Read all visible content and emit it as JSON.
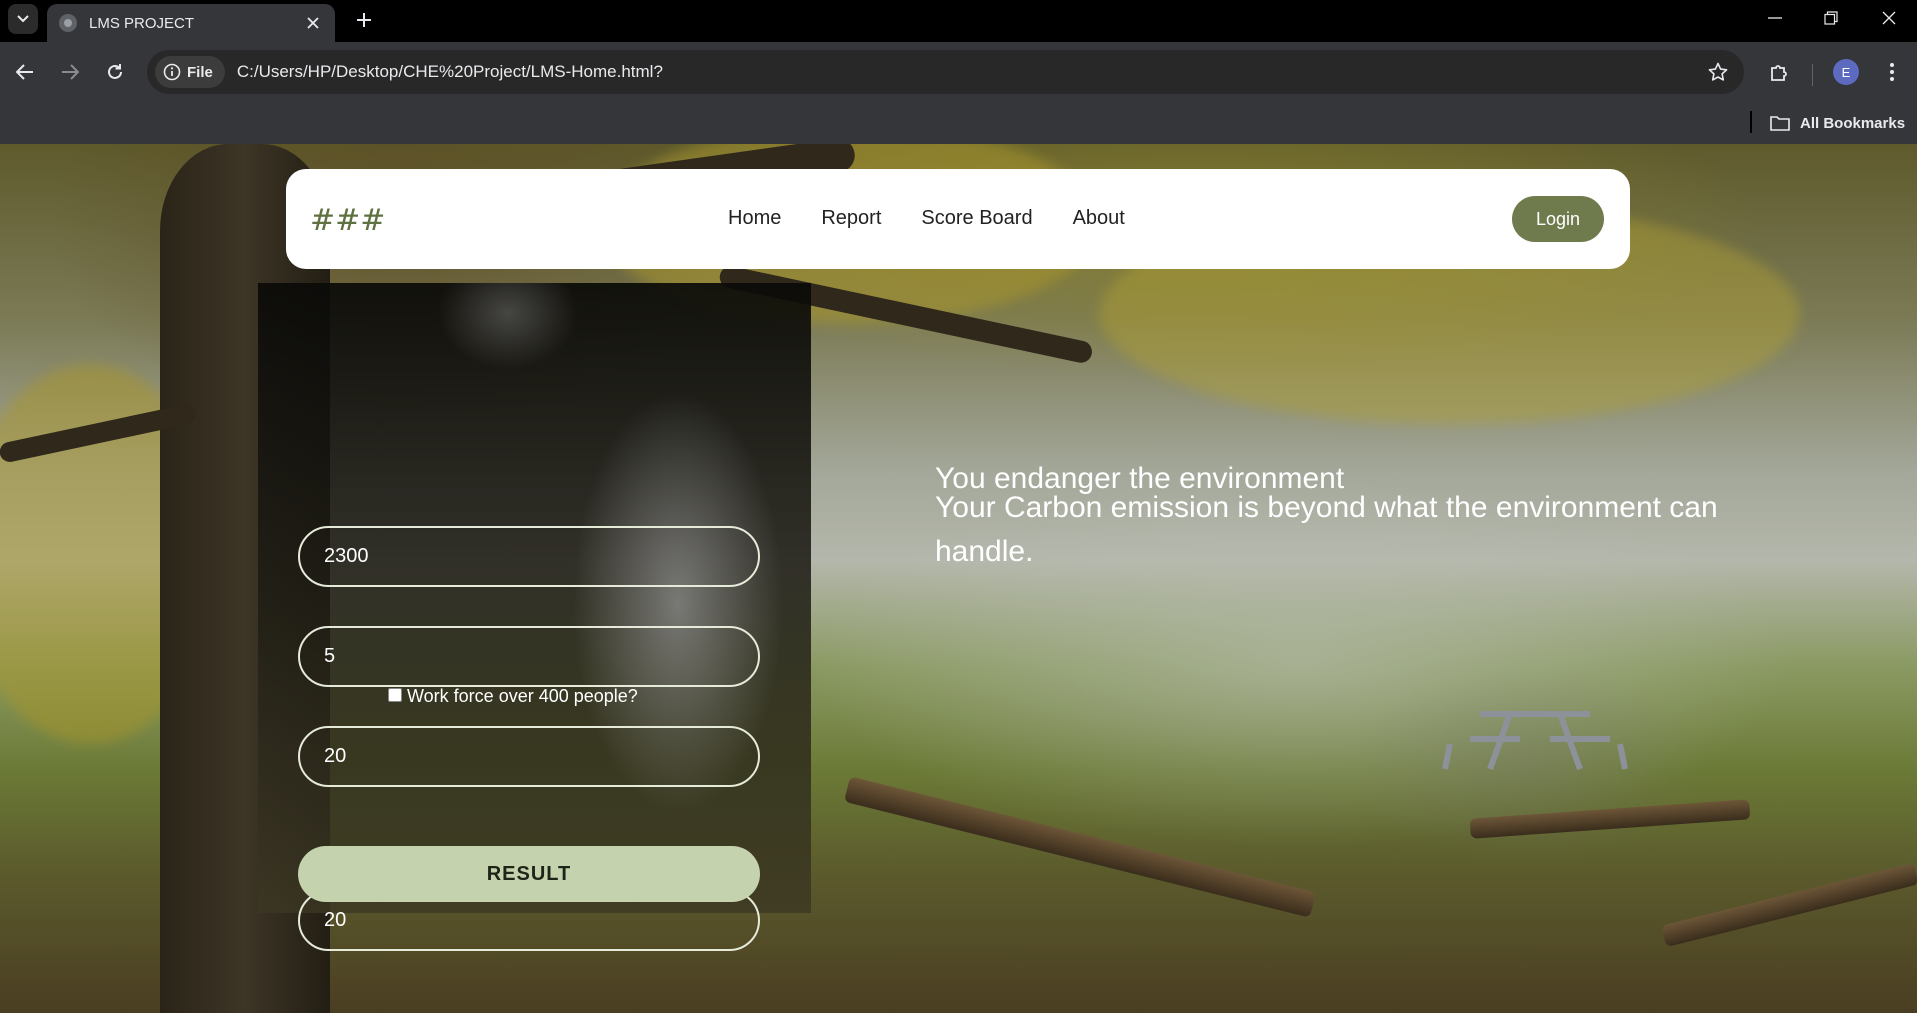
{
  "browser": {
    "tab_title": "LMS PROJECT",
    "site_chip_label": "File",
    "url": "C:/Users/HP/Desktop/CHE%20Project/LMS-Home.html?",
    "profile_initial": "E",
    "bookmarks_label": "All Bookmarks"
  },
  "site": {
    "logo": "###",
    "nav": [
      "Home",
      "Report",
      "Score Board",
      "About"
    ],
    "login_label": "Login"
  },
  "form": {
    "field_1": "2300",
    "field_2": "5",
    "field_3": "20",
    "checkbox_label": "Work force over 400 people?",
    "checkbox_checked": false,
    "field_4": "20",
    "result_label": "RESULT"
  },
  "message": {
    "title": "You endanger the environment",
    "body": "Your Carbon emission is beyond what the environment can handle."
  },
  "colors": {
    "accent_green": "#6f7b4d",
    "result_button": "#c4d3ad",
    "chrome_dark": "#35363a"
  }
}
